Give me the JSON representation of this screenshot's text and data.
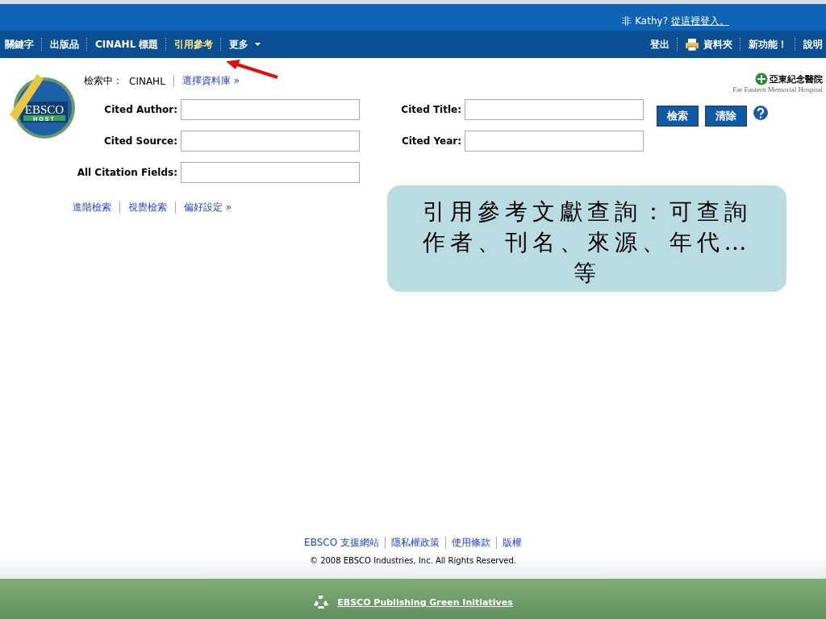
{
  "header": {
    "not_user": "非 Kathy?",
    "login_link": "從這裡登入。"
  },
  "nav": {
    "tabs": [
      {
        "label": "關鍵字",
        "selected": false
      },
      {
        "label": "出版品",
        "selected": false
      },
      {
        "label": "CINAHL 標題",
        "selected": false
      },
      {
        "label": "引用參考",
        "selected": true
      },
      {
        "label": "更多",
        "selected": false,
        "kind": "dropdown"
      }
    ],
    "right_links": [
      {
        "label": "登出",
        "kind": "text"
      },
      {
        "label": "資料夾",
        "kind": "folder"
      },
      {
        "label": "新功能！",
        "kind": "text"
      },
      {
        "label": "說明",
        "kind": "text"
      }
    ]
  },
  "logo": {
    "line1": "EBSCO",
    "line2": "HOST"
  },
  "hospital_logo": {
    "name": "亞東紀念醫院",
    "english": "Far Eastern Memorial Hospital"
  },
  "searching": {
    "label": "檢索中：",
    "database": "CINAHL",
    "choose_link": "選擇資料庫 »"
  },
  "fields": [
    {
      "label": "Cited Author:"
    },
    {
      "label": "Cited Title:"
    },
    {
      "label": "Cited Source:"
    },
    {
      "label": "Cited Year:"
    },
    {
      "label": "All Citation Fields:"
    }
  ],
  "buttons": [
    "檢索",
    "清除"
  ],
  "links": [
    "進階檢索",
    "視覺檢索",
    "偏好設定 »"
  ],
  "callout": {
    "text": "引用參考文獻查詢：可查詢作者、刊名、來源、年代…等"
  },
  "footer": {
    "links": [
      "EBSCO 支援網站",
      "隱私權政策",
      "使用條款",
      "版權"
    ],
    "copyright": "© 2008 EBSCO Industries, Inc. All Rights Reserved.",
    "green_link": "EBSCO Publishing Green Initiatives"
  }
}
